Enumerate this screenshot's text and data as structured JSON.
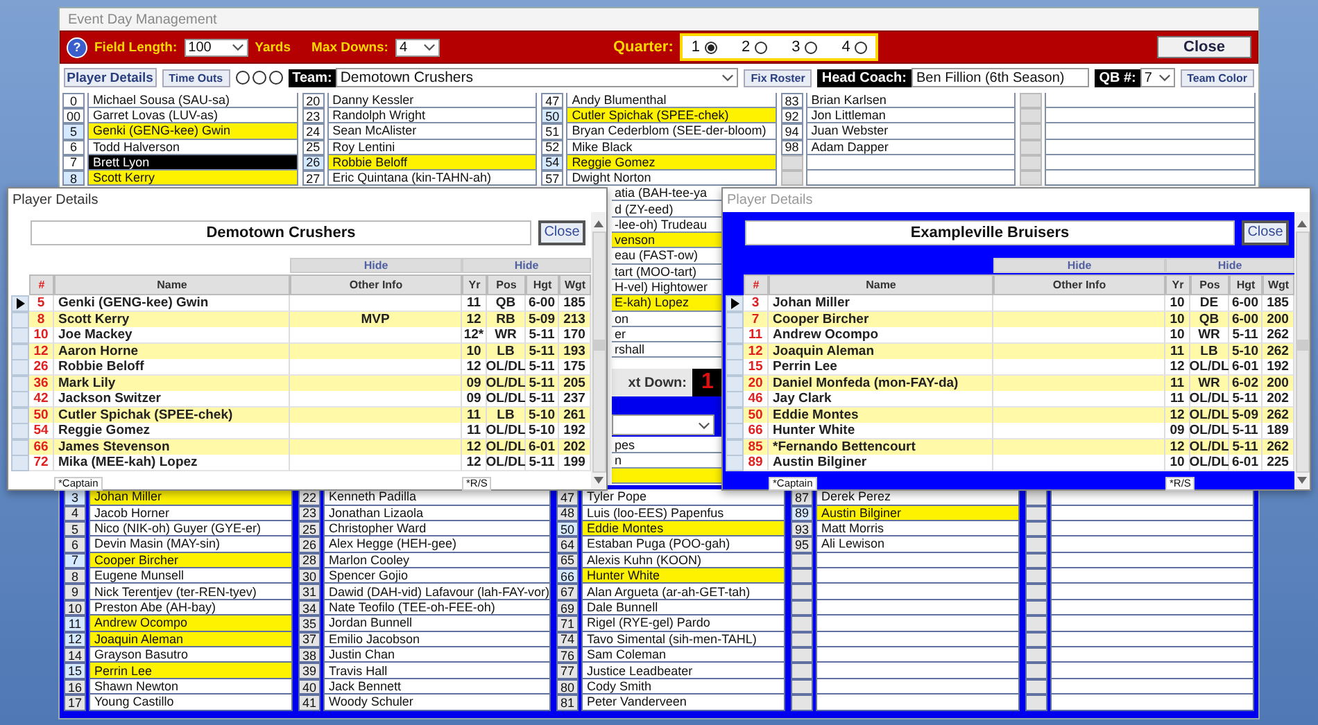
{
  "window": {
    "title": "Event Day Management"
  },
  "toolbar": {
    "help": "?",
    "field_length_label": "Field Length:",
    "field_length": "100",
    "yards_label": "Yards",
    "max_downs_label": "Max Downs:",
    "max_downs": "4",
    "quarter_label": "Quarter:",
    "quarters": [
      {
        "label": "1",
        "selected": true
      },
      {
        "label": "2",
        "selected": false
      },
      {
        "label": "3",
        "selected": false
      },
      {
        "label": "4",
        "selected": false
      }
    ],
    "close": "Close"
  },
  "team_bar": {
    "player_details": "Player Details",
    "time_outs": "Time Outs",
    "timeouts": [
      {
        "used": false
      },
      {
        "used": false
      },
      {
        "used": false
      }
    ],
    "team_label": "Team:",
    "team": "Demotown Crushers",
    "fix_roster": "Fix Roster",
    "coach_label": "Head Coach:",
    "coach": "Ben Fillion (6th Season)",
    "qb_label": "QB #:",
    "qb": "7",
    "team_color": "Team Color"
  },
  "top_roster": {
    "columns": [
      [
        {
          "number": "0",
          "name": "Michael Sousa (SAU-sa)",
          "highlighted": false,
          "selected": false
        },
        {
          "number": "00",
          "name": "Garret Lovas (LUV-as)",
          "highlighted": false,
          "selected": false
        },
        {
          "number": "5",
          "name": "Genki (GENG-kee) Gwin",
          "highlighted": true,
          "selected": false
        },
        {
          "number": "6",
          "name": "Todd Halverson",
          "highlighted": false,
          "selected": false
        },
        {
          "number": "7",
          "name": "Brett Lyon",
          "highlighted": false,
          "selected": true
        },
        {
          "number": "8",
          "name": "Scott Kerry",
          "highlighted": true,
          "selected": false
        }
      ],
      [
        {
          "number": "20",
          "name": "Danny Kessler",
          "highlighted": false,
          "selected": false
        },
        {
          "number": "23",
          "name": "Randolph Wright",
          "highlighted": false,
          "selected": false
        },
        {
          "number": "24",
          "name": "Sean McAlister",
          "highlighted": false,
          "selected": false
        },
        {
          "number": "25",
          "name": "Roy Lentini",
          "highlighted": false,
          "selected": false
        },
        {
          "number": "26",
          "name": "Robbie Beloff",
          "highlighted": true,
          "selected": false
        },
        {
          "number": "27",
          "name": "Eric Quintana (kin-TAHN-ah)",
          "highlighted": false,
          "selected": false
        }
      ],
      [
        {
          "number": "47",
          "name": "Andy Blumenthal",
          "highlighted": false,
          "selected": false
        },
        {
          "number": "50",
          "name": "Cutler Spichak (SPEE-chek)",
          "highlighted": true,
          "selected": false
        },
        {
          "number": "51",
          "name": "Bryan Cederblom (SEE-der-bloom)",
          "highlighted": false,
          "selected": false
        },
        {
          "number": "52",
          "name": "Mike Black",
          "highlighted": false,
          "selected": false
        },
        {
          "number": "54",
          "name": "Reggie Gomez",
          "highlighted": true,
          "selected": false
        },
        {
          "number": "57",
          "name": "Dwight Norton",
          "highlighted": false,
          "selected": false
        }
      ],
      [
        {
          "number": "83",
          "name": "Brian Karlsen",
          "highlighted": false,
          "selected": false
        },
        {
          "number": "92",
          "name": "Jon Littleman",
          "highlighted": false,
          "selected": false
        },
        {
          "number": "94",
          "name": "Juan Webster",
          "highlighted": false,
          "selected": false
        },
        {
          "number": "98",
          "name": "Adam Dapper",
          "highlighted": false,
          "selected": false
        }
      ]
    ]
  },
  "cut_rows": [
    {
      "text": "atia (BAH-tee-ya",
      "highlighted": false
    },
    {
      "text": "d (ZY-eed)",
      "highlighted": false
    },
    {
      "text": "-lee-oh) Trudeau",
      "highlighted": false
    },
    {
      "text": "venson",
      "highlighted": true
    },
    {
      "text": "eau (FAST-ow)",
      "highlighted": false
    },
    {
      "text": "tart (MOO-tart)",
      "highlighted": false
    },
    {
      "text": "H-vel) Hightower",
      "highlighted": false
    },
    {
      "text": "E-kah) Lopez",
      "highlighted": true
    },
    {
      "text": "on",
      "highlighted": false
    },
    {
      "text": "er",
      "highlighted": false
    },
    {
      "text": "rshall",
      "highlighted": false
    }
  ],
  "next_down": {
    "label": "xt Down:",
    "value": "1"
  },
  "lower_cut_rows": [
    {
      "text": "pes",
      "highlighted": false
    },
    {
      "text": "n",
      "highlighted": false
    },
    {
      "highlighted": true
    }
  ],
  "bottom_roster": {
    "columns": [
      [
        {
          "number": "3",
          "name": "Johan Miller",
          "highlighted": true
        },
        {
          "number": "4",
          "name": "Jacob Horner",
          "highlighted": false
        },
        {
          "number": "5",
          "name": "Nico (NIK-oh) Guyer (GYE-er)",
          "highlighted": false
        },
        {
          "number": "6",
          "name": "Devin Masin (MAY-sin)",
          "highlighted": false
        },
        {
          "number": "7",
          "name": "Cooper Bircher",
          "highlighted": true
        },
        {
          "number": "8",
          "name": "Eugene Munsell",
          "highlighted": false
        },
        {
          "number": "9",
          "name": "Nick Terentjev (ter-REN-tyev)",
          "highlighted": false
        },
        {
          "number": "10",
          "name": "Preston Abe (AH-bay)",
          "highlighted": false
        },
        {
          "number": "11",
          "name": "Andrew Ocompo",
          "highlighted": true
        },
        {
          "number": "12",
          "name": "Joaquin Aleman",
          "highlighted": true
        },
        {
          "number": "14",
          "name": "Grayson Basutro",
          "highlighted": false
        },
        {
          "number": "15",
          "name": "Perrin Lee",
          "highlighted": true
        },
        {
          "number": "16",
          "name": "Shawn Newton",
          "highlighted": false
        },
        {
          "number": "17",
          "name": "Young Castillo",
          "highlighted": false
        }
      ],
      [
        {
          "number": "22",
          "name": "Kenneth Padilla",
          "highlighted": false
        },
        {
          "number": "23",
          "name": "Jonathan Lizaola",
          "highlighted": false
        },
        {
          "number": "25",
          "name": "Christopher Ward",
          "highlighted": false
        },
        {
          "number": "26",
          "name": "Alex Hegge (HEH-gee)",
          "highlighted": false
        },
        {
          "number": "28",
          "name": "Marlon Cooley",
          "highlighted": false
        },
        {
          "number": "30",
          "name": "Spencer Gojio",
          "highlighted": false
        },
        {
          "number": "31",
          "name": "Dawid (DAH-vid) Lafavour (lah-FAY-vor)",
          "highlighted": false
        },
        {
          "number": "34",
          "name": "Nate Teofilo (TEE-oh-FEE-oh)",
          "highlighted": false
        },
        {
          "number": "35",
          "name": "Jordan Bunnell",
          "highlighted": false
        },
        {
          "number": "37",
          "name": "Emilio Jacobson",
          "highlighted": false
        },
        {
          "number": "38",
          "name": "Justin Chan",
          "highlighted": false
        },
        {
          "number": "39",
          "name": "Travis Hall",
          "highlighted": false
        },
        {
          "number": "40",
          "name": "Jack Bennett",
          "highlighted": false
        },
        {
          "number": "41",
          "name": "Woody Schuler",
          "highlighted": false
        }
      ],
      [
        {
          "number": "47",
          "name": "Tyler Pope",
          "highlighted": false
        },
        {
          "number": "48",
          "name": "Luis (loo-EES) Papenfus",
          "highlighted": false
        },
        {
          "number": "50",
          "name": "Eddie Montes",
          "highlighted": true
        },
        {
          "number": "64",
          "name": "Estaban Puga (POO-gah)",
          "highlighted": false
        },
        {
          "number": "65",
          "name": "Alexis Kuhn (KOON)",
          "highlighted": false
        },
        {
          "number": "66",
          "name": "Hunter White",
          "highlighted": true
        },
        {
          "number": "67",
          "name": "Alan Argueta (ar-ah-GET-tah)",
          "highlighted": false
        },
        {
          "number": "69",
          "name": "Dale Bunnell",
          "highlighted": false
        },
        {
          "number": "71",
          "name": "Rigel (RYE-gel) Pardo",
          "highlighted": false
        },
        {
          "number": "74",
          "name": "Tavo Simental (sih-men-TAHL)",
          "highlighted": false
        },
        {
          "number": "76",
          "name": "Sam Coleman",
          "highlighted": false
        },
        {
          "number": "77",
          "name": "Justice Leadbeater",
          "highlighted": false
        },
        {
          "number": "80",
          "name": "Cody Smith",
          "highlighted": false
        },
        {
          "number": "81",
          "name": "Peter Vanderveen",
          "highlighted": false
        }
      ],
      [
        {
          "number": "87",
          "name": "Derek Perez",
          "highlighted": false
        },
        {
          "number": "89",
          "name": "Austin Bilginer",
          "highlighted": true
        },
        {
          "number": "93",
          "name": "Matt Morris",
          "highlighted": false
        },
        {
          "number": "95",
          "name": "Ali Lewison",
          "highlighted": false
        }
      ]
    ]
  },
  "dialogs": [
    {
      "title": "Player Details",
      "active": true,
      "color": "#ffffff",
      "team": "Demotown Crushers",
      "close": "Close",
      "hide_labels": [
        "Hide",
        "Hide"
      ],
      "columns": [
        "#",
        "Name",
        "Other Info",
        "Yr",
        "Pos",
        "Hgt",
        "Wgt"
      ],
      "footnotes": [
        "*Captain",
        "*R/S"
      ],
      "rows": [
        {
          "number": "5",
          "name": "Genki (GENG-kee) Gwin",
          "yr": "11",
          "pos": "QB",
          "hgt": "6-00",
          "wgt": "185",
          "current": true
        },
        {
          "number": "8",
          "name": "Scott Kerry",
          "other_info": "MVP",
          "yr": "12",
          "pos": "RB",
          "hgt": "5-09",
          "wgt": "213",
          "current": false
        },
        {
          "number": "10",
          "name": "Joe Mackey",
          "yr": "12*",
          "pos": "WR",
          "hgt": "5-11",
          "wgt": "170",
          "current": false
        },
        {
          "number": "12",
          "name": "Aaron Horne",
          "yr": "10",
          "pos": "LB",
          "hgt": "5-11",
          "wgt": "193",
          "current": false
        },
        {
          "number": "26",
          "name": "Robbie Beloff",
          "yr": "12",
          "pos": "OL/DL",
          "hgt": "5-11",
          "wgt": "175",
          "current": false
        },
        {
          "number": "36",
          "name": "Mark Lily",
          "yr": "09",
          "pos": "OL/DL",
          "hgt": "5-11",
          "wgt": "205",
          "current": false
        },
        {
          "number": "42",
          "name": "Jackson Switzer",
          "yr": "09",
          "pos": "OL/DL",
          "hgt": "5-11",
          "wgt": "237",
          "current": false
        },
        {
          "number": "50",
          "name": "Cutler Spichak (SPEE-chek)",
          "yr": "11",
          "pos": "LB",
          "hgt": "5-10",
          "wgt": "261",
          "current": false
        },
        {
          "number": "54",
          "name": "Reggie Gomez",
          "yr": "11",
          "pos": "OL/DL",
          "hgt": "5-10",
          "wgt": "192",
          "current": false
        },
        {
          "number": "66",
          "name": "James Stevenson",
          "yr": "12",
          "pos": "OL/DL",
          "hgt": "6-01",
          "wgt": "202",
          "current": false
        },
        {
          "number": "72",
          "name": "Mika (MEE-kah) Lopez",
          "yr": "12",
          "pos": "OL/DL",
          "hgt": "5-11",
          "wgt": "199",
          "current": false
        }
      ]
    },
    {
      "title": "Player Details",
      "active": false,
      "color": "#0000ff",
      "team": "Exampleville Bruisers",
      "close": "Close",
      "hide_labels": [
        "Hide",
        "Hide"
      ],
      "columns": [
        "#",
        "Name",
        "Other Info",
        "Yr",
        "Pos",
        "Hgt",
        "Wgt"
      ],
      "footnotes": [
        "*Captain",
        "*R/S"
      ],
      "rows": [
        {
          "number": "3",
          "name": "Johan Miller",
          "yr": "10",
          "pos": "DE",
          "hgt": "6-00",
          "wgt": "185",
          "current": true
        },
        {
          "number": "7",
          "name": "Cooper Bircher",
          "yr": "10",
          "pos": "QB",
          "hgt": "6-00",
          "wgt": "200",
          "current": false
        },
        {
          "number": "11",
          "name": "Andrew Ocompo",
          "yr": "10",
          "pos": "WR",
          "hgt": "5-11",
          "wgt": "262",
          "current": false
        },
        {
          "number": "12",
          "name": "Joaquin Aleman",
          "yr": "11",
          "pos": "LB",
          "hgt": "5-10",
          "wgt": "262",
          "current": false
        },
        {
          "number": "15",
          "name": "Perrin Lee",
          "yr": "12",
          "pos": "OL/DL",
          "hgt": "6-01",
          "wgt": "192",
          "current": false
        },
        {
          "number": "20",
          "name": "Daniel Monfeda (mon-FAY-da)",
          "yr": "11",
          "pos": "WR",
          "hgt": "6-02",
          "wgt": "200",
          "current": false
        },
        {
          "number": "46",
          "name": "Jay Clark",
          "yr": "11",
          "pos": "OL/DL",
          "hgt": "5-11",
          "wgt": "202",
          "current": false
        },
        {
          "number": "50",
          "name": "Eddie Montes",
          "yr": "12",
          "pos": "OL/DL",
          "hgt": "5-09",
          "wgt": "262",
          "current": false
        },
        {
          "number": "66",
          "name": "Hunter White",
          "yr": "09",
          "pos": "OL/DL",
          "hgt": "5-11",
          "wgt": "189",
          "current": false
        },
        {
          "number": "85",
          "name": "*Fernando Bettencourt",
          "yr": "12",
          "pos": "OL/DL",
          "hgt": "5-11",
          "wgt": "262",
          "current": false
        },
        {
          "number": "89",
          "name": "Austin Bilginer",
          "yr": "10",
          "pos": "OL/DL",
          "hgt": "6-01",
          "wgt": "225",
          "current": false
        }
      ]
    }
  ]
}
